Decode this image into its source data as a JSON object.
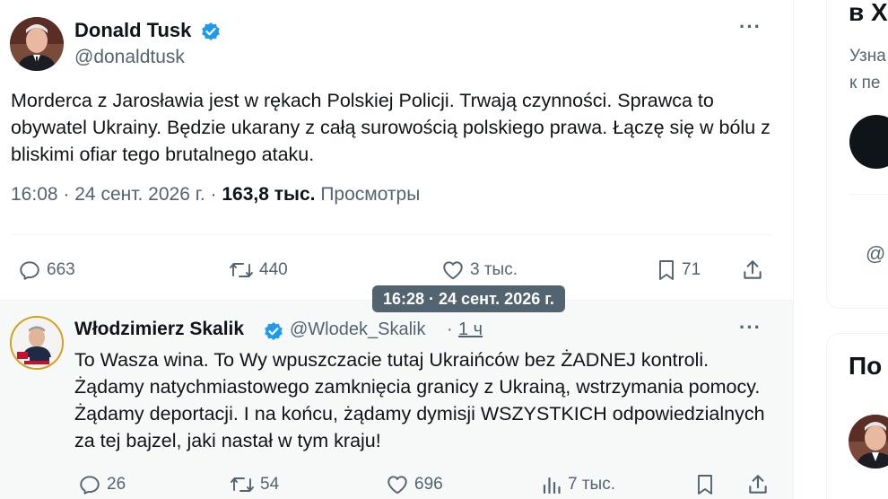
{
  "tweet": {
    "author_name": "Donald Tusk",
    "author_handle": "@donaldtusk",
    "text": "Morderca z Jarosławia jest w rękach Polskiej Policji. Trwają czynności. Sprawca to obywatel Ukrainy. Będzie ukarany z całą surowością polskiego prawa. Łączę się w bólu z bliskimi ofiar tego brutalnego ataku.",
    "time": "16:08",
    "date": "24 сент. 2026 г.",
    "views_count": "163,8 тыс.",
    "views_label": "Просмотры",
    "sep": "·",
    "replies": "663",
    "retweets": "440",
    "likes": "3 тыс.",
    "bookmarks": "71"
  },
  "tooltip": {
    "text": "16:28 · 24 сент. 2026 г."
  },
  "reply": {
    "author_name": "Włodzimierz Skalik",
    "author_handle": "@Wlodek_Skalik",
    "sep": "·",
    "age": "1 ч",
    "text": "To Wasza wina. To Wy wpuszczacie tutaj Ukraińców bez ŻADNEJ kontroli. Żądamy natychmiastowego zamknięcia granicy z Ukrainą, wstrzymania pomocy. Żądamy deportacji. I na końcu, żądamy dymisji WSZYSTKICH odpowiedzialnych za tej bajzel, jaki nastał w tym kraju!",
    "replies": "26",
    "retweets": "54",
    "likes": "696",
    "views": "7 тыс."
  },
  "sidebar": {
    "card1_title": "в X",
    "card1_line1": "Узна",
    "card1_line2": "к пе",
    "card1_at": "@",
    "card2_title": "По"
  },
  "colors": {
    "verified": "#1d9bf0",
    "text_primary": "#0f1419",
    "text_secondary": "#536471",
    "tooltip_bg": "#536471",
    "reply_bg": "#f7f9f9"
  }
}
